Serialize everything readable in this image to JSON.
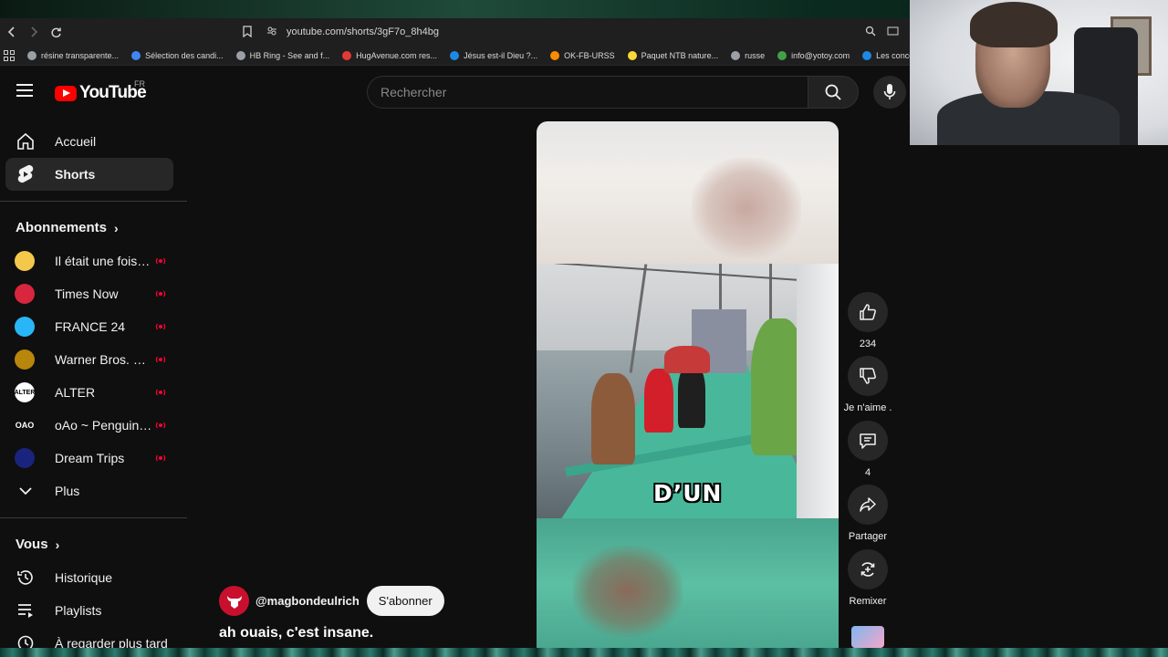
{
  "browser": {
    "url": "youtube.com/shorts/3gF7o_8h4bg",
    "bookmarks": [
      {
        "label": "résine transparente...",
        "color": "#9aa0a6"
      },
      {
        "label": "Sélection des candi...",
        "color": "#4285f4"
      },
      {
        "label": "HB Ring - See and f...",
        "color": "#9aa0a6"
      },
      {
        "label": "HugAvenue.com res...",
        "color": "#e53935"
      },
      {
        "label": "Jésus est-il Dieu ?...",
        "color": "#1e88e5"
      },
      {
        "label": "OK-FB-URSS",
        "color": "#fb8c00"
      },
      {
        "label": "Paquet NTB nature...",
        "color": "#fdd835"
      },
      {
        "label": "russe",
        "color": "#9aa0a6"
      },
      {
        "label": "info@yotoy.com",
        "color": "#43a047"
      },
      {
        "label": "Les concours d'",
        "color": "#1e88e5"
      }
    ]
  },
  "header": {
    "logo_text": "YouTube",
    "country_code": "FR",
    "search_placeholder": "Rechercher"
  },
  "sidebar": {
    "main": [
      {
        "label": "Accueil",
        "icon": "home-icon"
      },
      {
        "label": "Shorts",
        "icon": "shorts-icon",
        "active": true
      }
    ],
    "subscriptions_title": "Abonnements",
    "subscriptions": [
      {
        "label": "Il était une fois... ...",
        "avatar_color": "#f4c84a",
        "live": true
      },
      {
        "label": "Times Now",
        "avatar_color": "#d7263d",
        "live": true
      },
      {
        "label": "FRANCE 24",
        "avatar_color": "#29b6f6",
        "live": true
      },
      {
        "label": "Warner Bros. Ent...",
        "avatar_color": "#b8860b",
        "live": true
      },
      {
        "label": "ALTER",
        "avatar_color": "#ffffff",
        "avatar_text": "ALTER",
        "live": true
      },
      {
        "label": "oAo ~ Penguin J...",
        "avatar_color": "#0f0f0f",
        "avatar_text": "OAO",
        "live": true
      },
      {
        "label": "Dream Trips",
        "avatar_color": "#1a237e",
        "live": true
      }
    ],
    "more_label": "Plus",
    "you_title": "Vous",
    "you_items": [
      {
        "label": "Historique",
        "icon": "history-icon"
      },
      {
        "label": "Playlists",
        "icon": "playlists-icon"
      },
      {
        "label": "À regarder plus tard",
        "icon": "watch-later-icon"
      }
    ]
  },
  "short": {
    "caption_overlay": "D’UN",
    "channel_handle": "@magbondeulrich",
    "subscribe_label": "S'abonner",
    "title": "ah ouais, c'est insane."
  },
  "actions": {
    "like_count": "234",
    "dislike_label": "Je n'aime .",
    "comment_count": "4",
    "share_label": "Partager",
    "remix_label": "Remixer"
  },
  "colors": {
    "background": "#0f0f0f",
    "accent": "#ff0000",
    "live": "#ff0033"
  }
}
